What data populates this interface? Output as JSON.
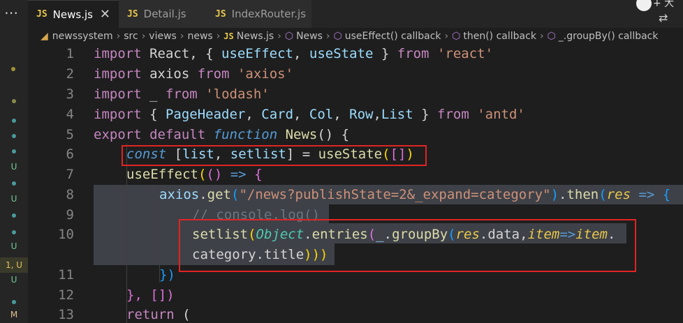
{
  "tabs": [
    {
      "icon": "JS",
      "label": "News.js",
      "active": true
    },
    {
      "icon": "JS",
      "label": "Detail.js",
      "active": false
    },
    {
      "icon": "JS",
      "label": "IndexRouter.js",
      "active": false
    }
  ],
  "topright": {
    "plus_label": "+ 大"
  },
  "breadcrumb": {
    "items": [
      "newssystem",
      "src",
      "views",
      "news",
      "News.js",
      "News",
      "useEffect() callback",
      "then() callback",
      "_.groupBy() callback"
    ]
  },
  "gutter_markers": [
    "U",
    "U",
    "U",
    "1, U",
    "U",
    "M"
  ],
  "line_numbers": [
    "1",
    "2",
    "3",
    "4",
    "5",
    "6",
    "7",
    "8",
    "9",
    "10",
    "11",
    "12",
    "13"
  ],
  "code": {
    "l1": [
      "import",
      " React, { ",
      "useEffect",
      ", ",
      "useState",
      " } ",
      "from",
      " ",
      "'react'"
    ],
    "l2": [
      "import",
      " axios ",
      "from",
      " ",
      "'axios'"
    ],
    "l3": [
      "import",
      " _ ",
      "from",
      " ",
      "'lodash'"
    ],
    "l4": [
      "import",
      " { ",
      "PageHeader",
      ", ",
      "Card",
      ", ",
      "Col",
      ", ",
      "Row",
      ",",
      "List",
      " } ",
      "from",
      " ",
      "'antd'"
    ],
    "l5": [
      "export",
      " ",
      "default",
      " ",
      "function",
      " ",
      "News",
      "() {"
    ],
    "l6": [
      "const",
      " [",
      "list",
      ", ",
      "setlist",
      "] = ",
      "useState",
      "(",
      "[]",
      ")"
    ],
    "l7": [
      "useEffect",
      "(",
      "()",
      " => ",
      "{"
    ],
    "l8": [
      "axios",
      ".",
      "get",
      "(",
      "\"/news?publishState=2&_expand=category\"",
      ")",
      ".",
      "then",
      "(",
      "res",
      " => ",
      "{"
    ],
    "l9": [
      "// console.log()"
    ],
    "l10a": [
      "setlist",
      "(",
      "Object",
      ".",
      "entries",
      "(",
      "_",
      ".",
      "groupBy",
      "(",
      "res",
      ".data,",
      "item",
      "=>",
      "item",
      "."
    ],
    "l10b": [
      "category.title",
      ")))"
    ],
    "l11": [
      "})"
    ],
    "l12": [
      "}, [])"
    ],
    "l13": [
      "return",
      " ("
    ]
  }
}
